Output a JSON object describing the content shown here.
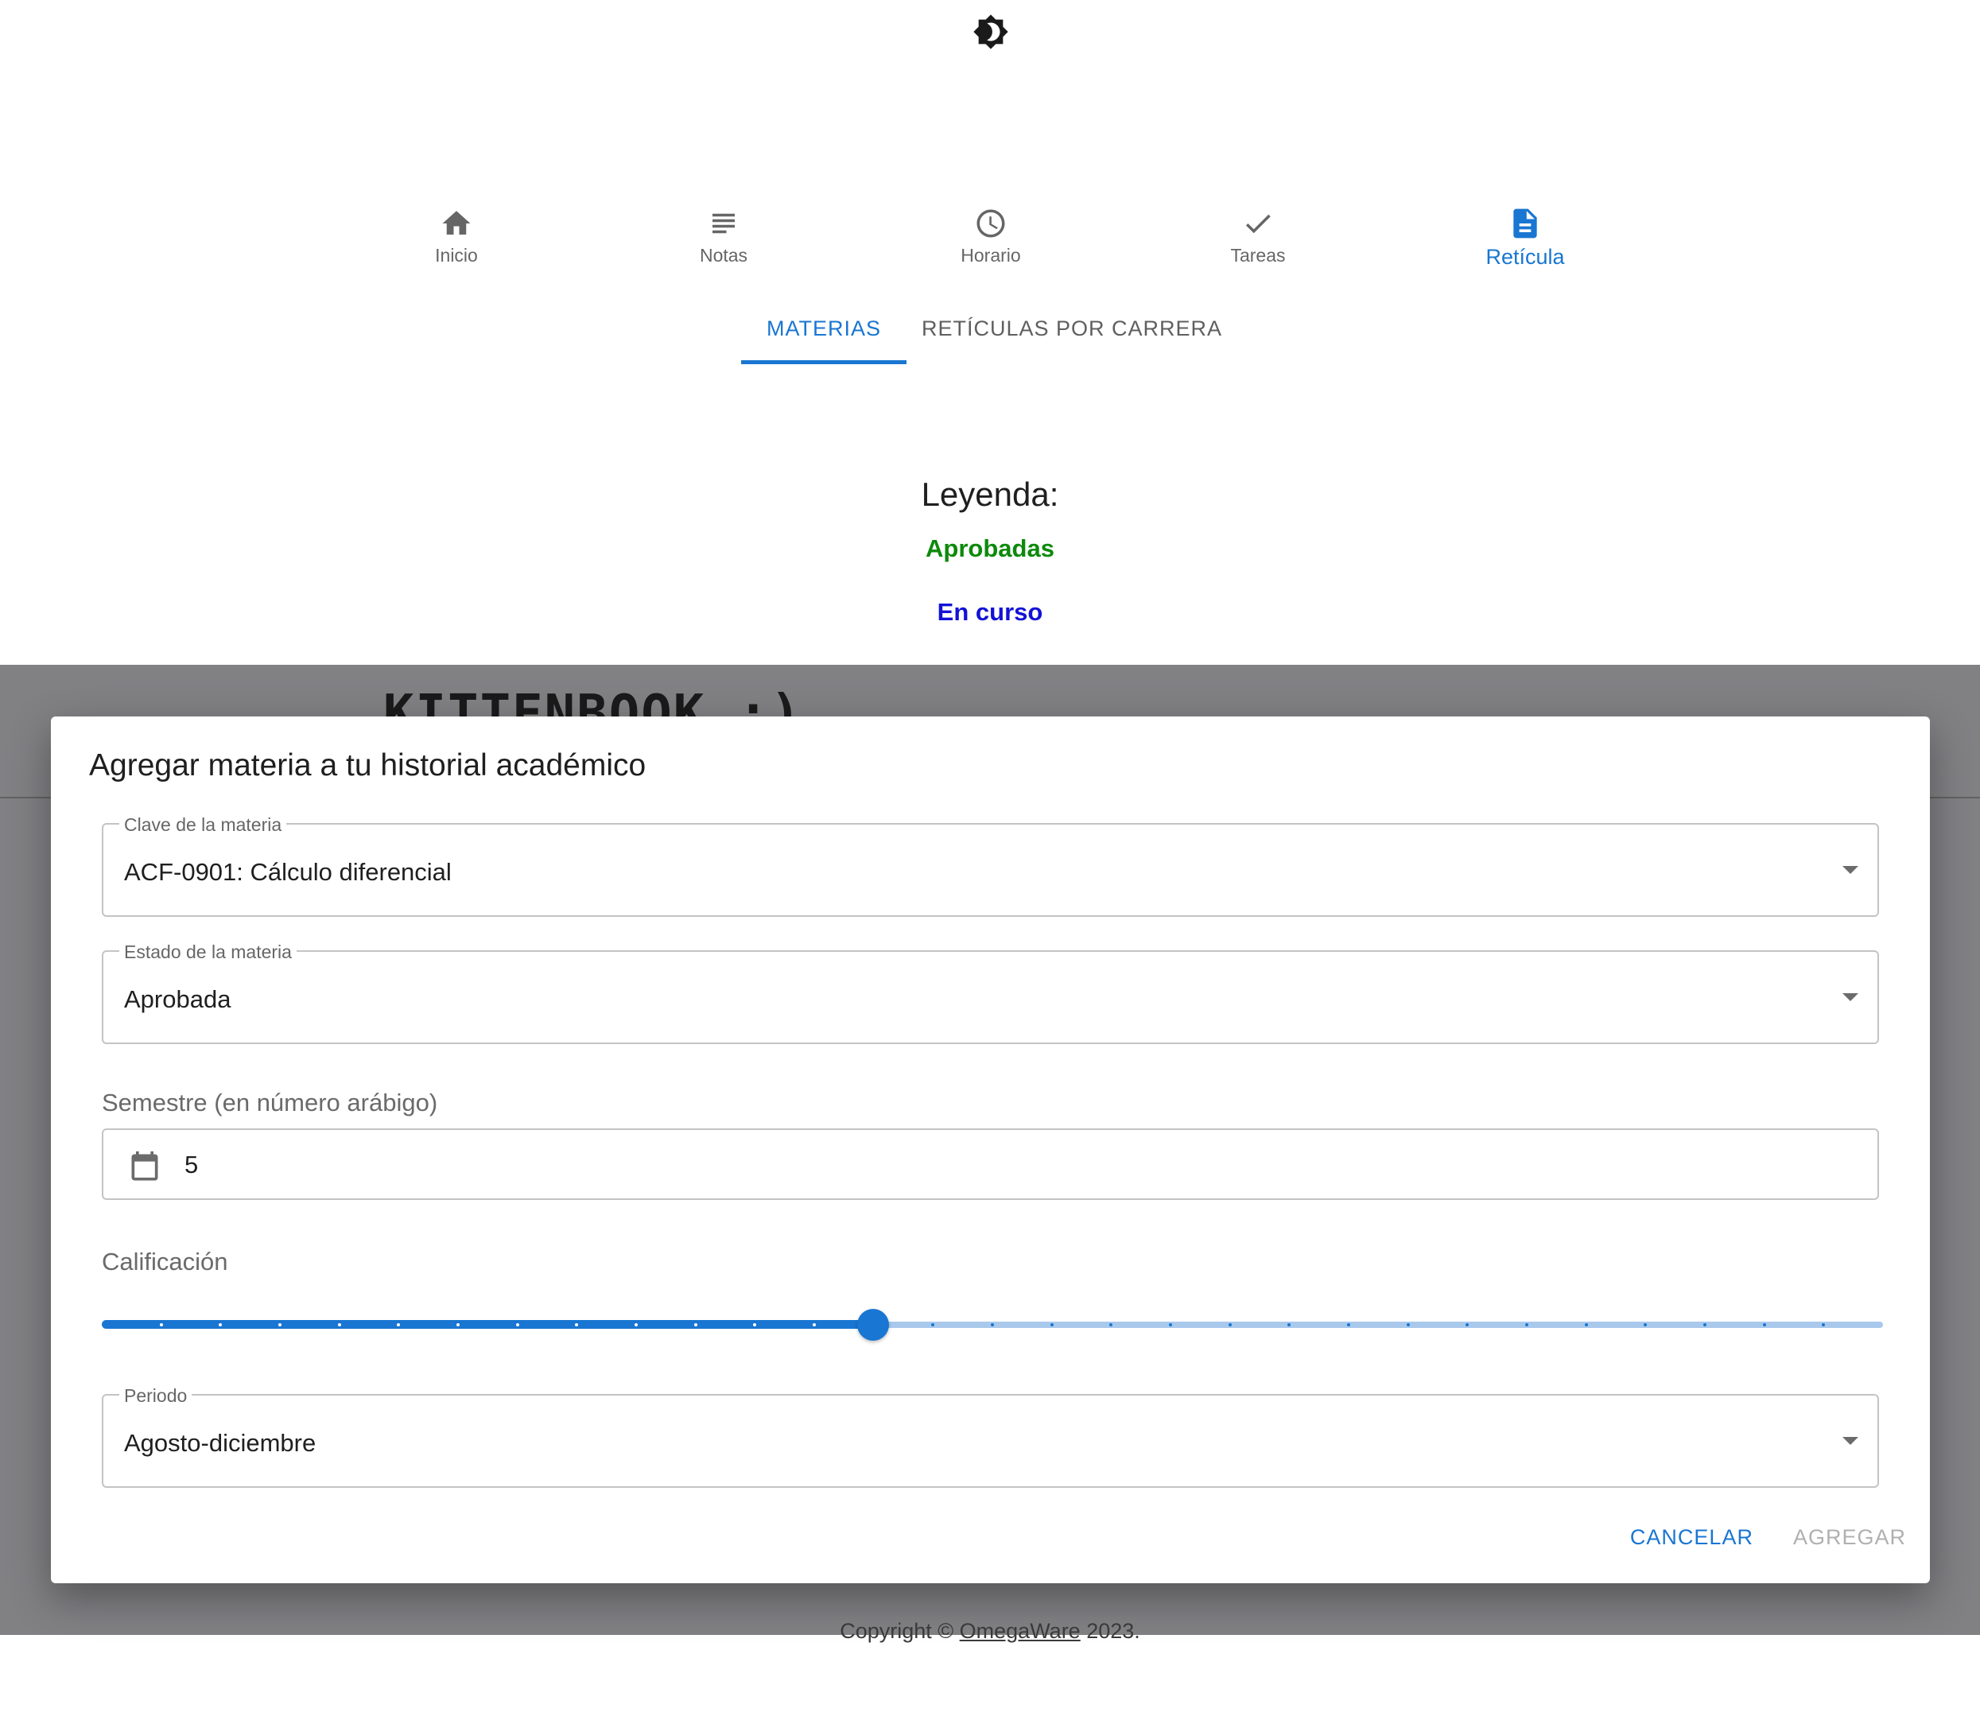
{
  "header": {
    "theme_toggle_icon": "brightness-icon"
  },
  "bottom_nav": {
    "items": [
      {
        "label": "Inicio",
        "icon": "home-icon"
      },
      {
        "label": "Notas",
        "icon": "notes-icon"
      },
      {
        "label": "Horario",
        "icon": "clock-icon"
      },
      {
        "label": "Tareas",
        "icon": "check-icon"
      },
      {
        "label": "Retícula",
        "icon": "document-icon"
      }
    ],
    "active_index": 4,
    "accent_color": "#1976d2"
  },
  "tabs": {
    "items": [
      {
        "label": "MATERIAS"
      },
      {
        "label": "RETÍCULAS POR CARRERA"
      }
    ],
    "active_index": 0
  },
  "legend": {
    "title": "Leyenda:",
    "approved": "Aprobadas",
    "approved_color": "#0c8a0c",
    "current": "En curso",
    "current_color": "#1212d6"
  },
  "background": {
    "logo_text": "KITTENBOOK :)"
  },
  "dialog": {
    "title": "Agregar materia a tu historial académico",
    "clave": {
      "label": "Clave de la materia",
      "value": "ACF-0901: Cálculo diferencial"
    },
    "estado": {
      "label": "Estado de la materia",
      "value": "Aprobada"
    },
    "semestre": {
      "label": "Semestre (en número arábigo)",
      "value": "5",
      "icon": "calendar-icon"
    },
    "calificacion": {
      "label": "Calificación",
      "step_count": 30,
      "value_fraction": 0.433
    },
    "periodo": {
      "label": "Periodo",
      "value": "Agosto-diciembre"
    },
    "actions": {
      "cancel": "CANCELAR",
      "add": "AGREGAR"
    }
  },
  "footer": {
    "prefix": "Copyright © ",
    "link": "OmegaWare",
    "suffix": " 2023."
  }
}
